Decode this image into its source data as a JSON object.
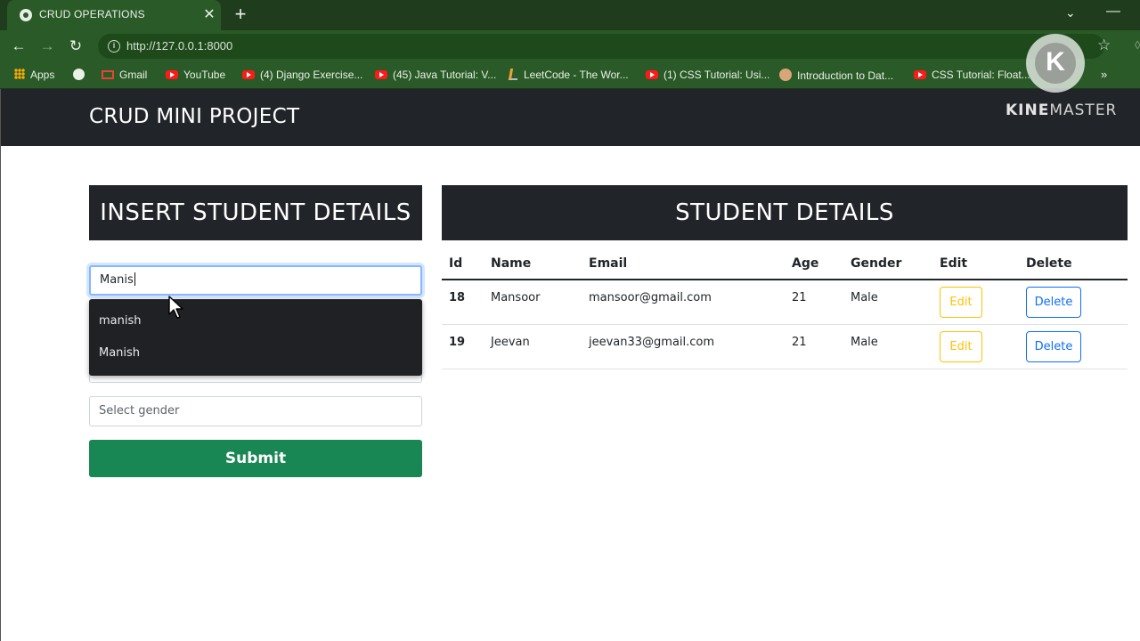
{
  "browser": {
    "tab_title": "CRUD OPERATIONS",
    "tab_close": "✕",
    "new_tab": "+",
    "url": "http://127.0.0.1:8000",
    "bookmarks": [
      {
        "label": "Apps",
        "icon": "apps-icon"
      },
      {
        "label": "",
        "icon": "globe-icon"
      },
      {
        "label": "Gmail",
        "icon": "gmail-icon"
      },
      {
        "label": "YouTube",
        "icon": "youtube-icon"
      },
      {
        "label": "(4) Django Exercise...",
        "icon": "youtube-icon"
      },
      {
        "label": "(45) Java Tutorial: V...",
        "icon": "youtube-icon"
      },
      {
        "label": "LeetCode - The Wor...",
        "icon": "leetcode-icon"
      },
      {
        "label": "(1) CSS Tutorial: Usi...",
        "icon": "youtube-icon"
      },
      {
        "label": "Introduction to Dat...",
        "icon": "profile-icon"
      },
      {
        "label": "CSS Tutorial: Float...",
        "icon": "youtube-icon"
      }
    ]
  },
  "watermark": {
    "logo_letter": "K",
    "text_bold": "KINE",
    "text": "MASTER"
  },
  "navbar": {
    "brand": "CRUD MINI PROJECT"
  },
  "form": {
    "heading": "INSERT STUDENT DETAILS",
    "name_value": "Manis",
    "autocomplete": [
      "manish",
      "Manish"
    ],
    "gender_placeholder": "Select gender",
    "submit_label": "Submit"
  },
  "table": {
    "heading": "STUDENT DETAILS",
    "columns": [
      "Id",
      "Name",
      "Email",
      "Age",
      "Gender",
      "Edit",
      "Delete"
    ],
    "rows": [
      {
        "id": "18",
        "name": "Mansoor",
        "email": "mansoor@gmail.com",
        "age": "21",
        "gender": "Male",
        "edit": "Edit",
        "delete": "Delete"
      },
      {
        "id": "19",
        "name": "Jeevan",
        "email": "jeevan33@gmail.com",
        "age": "21",
        "gender": "Male",
        "edit": "Edit",
        "delete": "Delete"
      }
    ]
  },
  "colors": {
    "navbar": "#212529",
    "submit": "#198754",
    "edit": "#ffc107",
    "delete": "#0d6efd",
    "browser_frame": "#2a5a27"
  }
}
